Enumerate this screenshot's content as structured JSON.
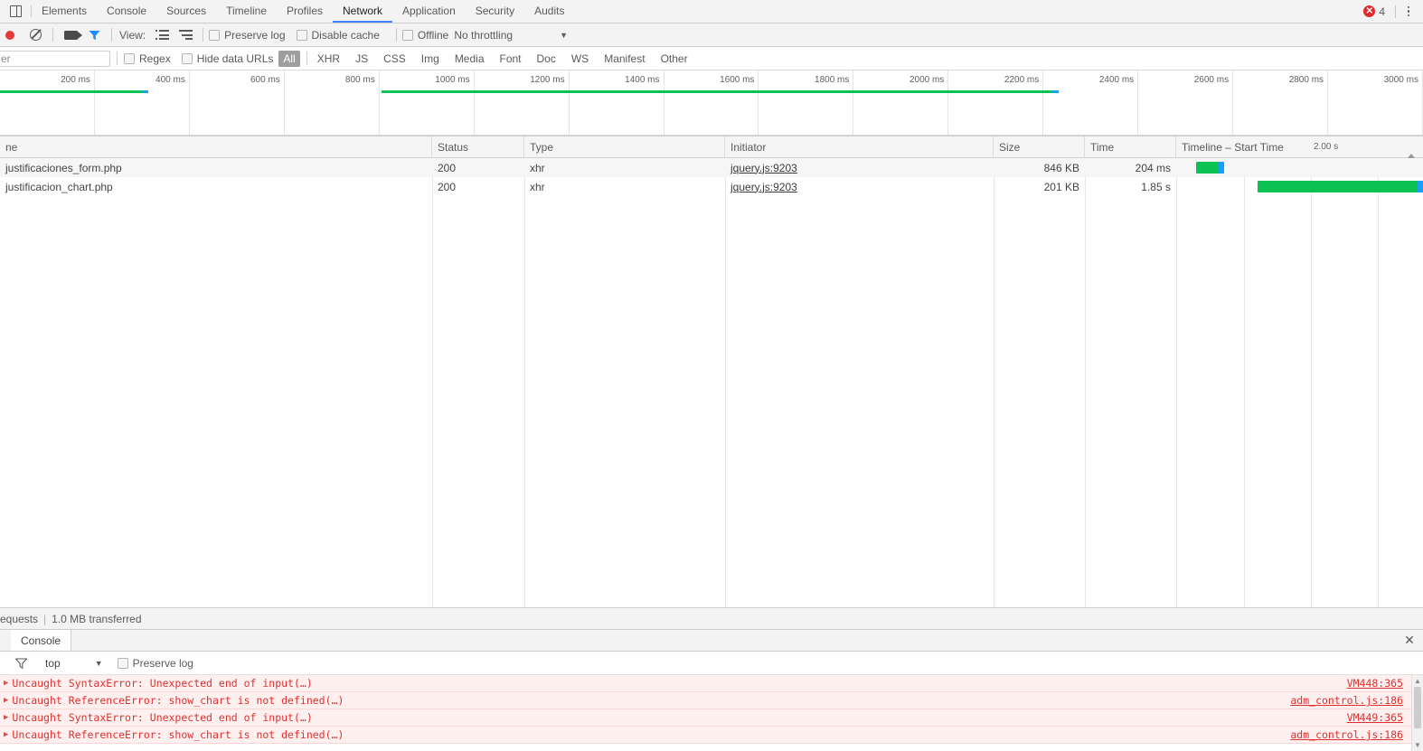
{
  "window": {
    "dock_icon": "dock-panel-icon",
    "error_badge": {
      "icon": "error-circle-icon",
      "count": "4"
    },
    "menu_icon": "kebab-menu-icon"
  },
  "tabs": [
    {
      "label": "Elements",
      "active": false
    },
    {
      "label": "Console",
      "active": false
    },
    {
      "label": "Sources",
      "active": false
    },
    {
      "label": "Timeline",
      "active": false
    },
    {
      "label": "Profiles",
      "active": false
    },
    {
      "label": "Network",
      "active": true
    },
    {
      "label": "Application",
      "active": false
    },
    {
      "label": "Security",
      "active": false
    },
    {
      "label": "Audits",
      "active": false
    }
  ],
  "network_toolbar": {
    "record_icon": "record-button-icon",
    "clear_icon": "clear-icon",
    "camera_icon": "capture-screenshots-icon",
    "filter_icon": "filter-funnel-icon",
    "view_label": "View:",
    "view_list_icon": "view-list-icon",
    "view_waterfall_icon": "view-waterfall-icon",
    "preserve_log_label": "Preserve log",
    "disable_cache_label": "Disable cache",
    "offline_label": "Offline",
    "throttling_value": "No throttling",
    "throttling_arrow_icon": "chevron-down-icon"
  },
  "filter_bar": {
    "input_value": "er",
    "input_placeholder": "Filter",
    "regex_label": "Regex",
    "hide_data_urls_label": "Hide data URLs",
    "types": [
      {
        "label": "All",
        "active": true
      },
      {
        "label": "XHR",
        "active": false
      },
      {
        "label": "JS",
        "active": false
      },
      {
        "label": "CSS",
        "active": false
      },
      {
        "label": "Img",
        "active": false
      },
      {
        "label": "Media",
        "active": false
      },
      {
        "label": "Font",
        "active": false
      },
      {
        "label": "Doc",
        "active": false
      },
      {
        "label": "WS",
        "active": false
      },
      {
        "label": "Manifest",
        "active": false
      },
      {
        "label": "Other",
        "active": false
      }
    ]
  },
  "overview": {
    "ticks": [
      "200 ms",
      "400 ms",
      "600 ms",
      "800 ms",
      "1000 ms",
      "1200 ms",
      "1400 ms",
      "1600 ms",
      "1800 ms",
      "2000 ms",
      "2200 ms",
      "2400 ms",
      "2600 ms",
      "2800 ms",
      "3000 ms"
    ],
    "bands": [
      {
        "left_pct": 0.0,
        "width_pct": 10.4
      },
      {
        "left_pct": 26.8,
        "width_pct": 47.6
      }
    ],
    "band_color": "#0cc254",
    "band_tip_color": "#1a9ffa"
  },
  "table": {
    "columns": [
      {
        "label": "Name",
        "display": "ne"
      },
      {
        "label": "Status"
      },
      {
        "label": "Type"
      },
      {
        "label": "Initiator"
      },
      {
        "label": "Size"
      },
      {
        "label": "Time"
      },
      {
        "label": "Timeline – Start Time"
      }
    ],
    "timeline_tick": "2.00 s",
    "sort_indicator_icon": "sort-ascending-icon",
    "rows": [
      {
        "name": "justificaciones_form.php",
        "status": "200",
        "type": "xhr",
        "initiator": "jquery.js:9203",
        "size": "846 KB",
        "time": "204 ms",
        "bar_left_pct": 8.0,
        "bar_width_pct": 11.5
      },
      {
        "name": "justificacion_chart.php",
        "status": "200",
        "type": "xhr",
        "initiator": "jquery.js:9203",
        "size": "201 KB",
        "time": "1.85 s",
        "bar_left_pct": 33.0,
        "bar_width_pct": 67.0
      }
    ]
  },
  "status_bar": {
    "requests": "equests",
    "separator": "|",
    "transferred": "1.0 MB transferred"
  },
  "drawer": {
    "tab_label": "Console",
    "close_icon": "close-icon",
    "filter_icon": "filter-funnel-icon",
    "context": "top",
    "context_arrow_icon": "chevron-down-icon",
    "preserve_log_label": "Preserve log",
    "messages": [
      {
        "expand_icon": "triangle-right-icon",
        "text": "Uncaught SyntaxError: Unexpected end of input(…)",
        "source": "VM448:365"
      },
      {
        "expand_icon": "triangle-right-icon",
        "text": "Uncaught ReferenceError: show_chart is not defined(…)",
        "source": "adm_control.js:186"
      },
      {
        "expand_icon": "triangle-right-icon",
        "text": "Uncaught SyntaxError: Unexpected end of input(…)",
        "source": "VM449:365"
      },
      {
        "expand_icon": "triangle-right-icon",
        "text": "Uncaught ReferenceError: show_chart is not defined(…)",
        "source": "adm_control.js:186"
      }
    ],
    "scrollbar": {
      "up_icon": "scroll-up-arrow-icon",
      "down_icon": "scroll-down-arrow-icon"
    }
  },
  "colors": {
    "accent": "#4285f4",
    "error": "#df2b2b",
    "bar_green": "#0cc254",
    "bar_blue": "#1a9ffa"
  }
}
